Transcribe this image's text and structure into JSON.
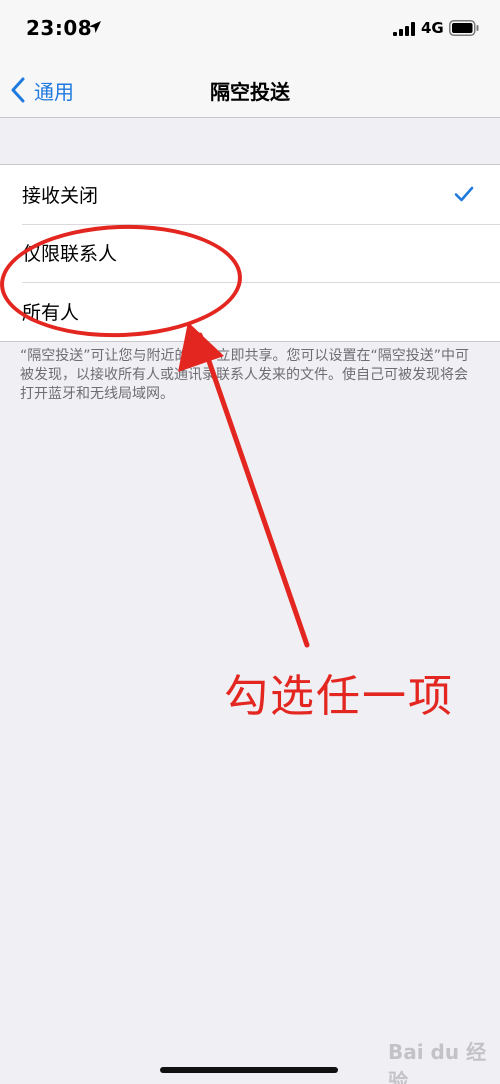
{
  "status_bar": {
    "time": "23:08",
    "network": "4G",
    "icons": [
      "location-arrow-icon",
      "signal-icon",
      "battery-icon"
    ]
  },
  "nav": {
    "back_label": "通用",
    "title": "隔空投送"
  },
  "options": [
    {
      "label": "接收关闭",
      "selected": true
    },
    {
      "label": "仅限联系人",
      "selected": false
    },
    {
      "label": "所有人",
      "selected": false
    }
  ],
  "footer_note": "“隔空投送”可让您与附近的用户立即共享。您可以设置在“隔空投送”中可被发现，以接收所有人或通讯录联系人发来的文件。使自己可被发现将会打开蓝牙和无线局域网。",
  "annotation": {
    "text": "勾选任一项"
  },
  "watermark": "Bai du 经验",
  "colors": {
    "accent": "#1f7ae0",
    "annotation": "#e3261f",
    "background": "#efeff4"
  }
}
